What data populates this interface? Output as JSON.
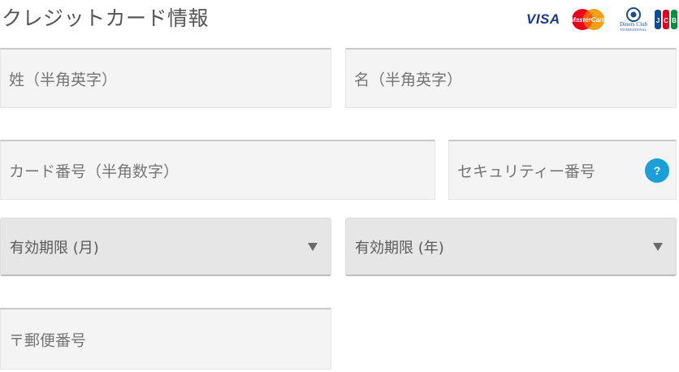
{
  "header": {
    "title": "クレジットカード情報",
    "brands": [
      {
        "name": "VISA",
        "icon": "visa-logo"
      },
      {
        "name": "MasterCard",
        "icon": "mastercard-logo"
      },
      {
        "name": "Diners Club International",
        "icon": "diners-club-logo"
      },
      {
        "name": "JCB",
        "icon": "jcb-logo"
      }
    ]
  },
  "form": {
    "last_name_placeholder": "姓（半角英字）",
    "first_name_placeholder": "名（半角英字）",
    "card_number_placeholder": "カード番号（半角数字）",
    "security_code_placeholder": "セキュリティー番号",
    "security_help_label": "?",
    "expiry_month_value": "有効期限 (月)",
    "expiry_year_value": "有効期限 (年)",
    "postal_code_placeholder": "〒郵便番号"
  },
  "colors": {
    "help_badge": "#1b9fd9",
    "field_bg": "#f4f4f4",
    "select_bg": "#e6e6e6"
  }
}
